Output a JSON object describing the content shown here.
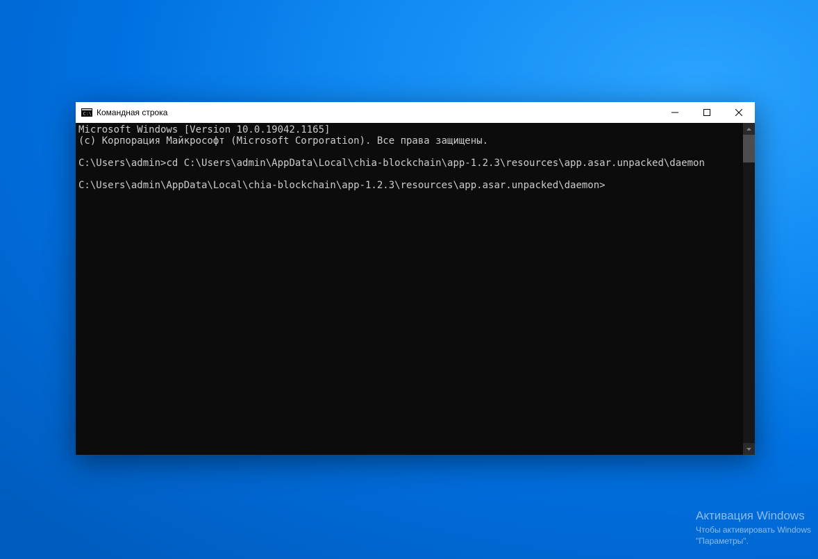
{
  "window": {
    "title": "Командная строка"
  },
  "terminal": {
    "line1": "Microsoft Windows [Version 10.0.19042.1165]",
    "line2": "(c) Корпорация Майкрософт (Microsoft Corporation). Все права защищены.",
    "prompt1_path": "C:\\Users\\admin>",
    "prompt1_cmd": "cd C:\\Users\\admin\\AppData\\Local\\chia-blockchain\\app-1.2.3\\resources\\app.asar.unpacked\\daemon",
    "prompt2_path": "C:\\Users\\admin\\AppData\\Local\\chia-blockchain\\app-1.2.3\\resources\\app.asar.unpacked\\daemon>",
    "prompt2_cmd": ""
  },
  "watermark": {
    "title": "Активация Windows",
    "sub1": "Чтобы активировать Windows",
    "sub2": "\"Параметры\"."
  }
}
